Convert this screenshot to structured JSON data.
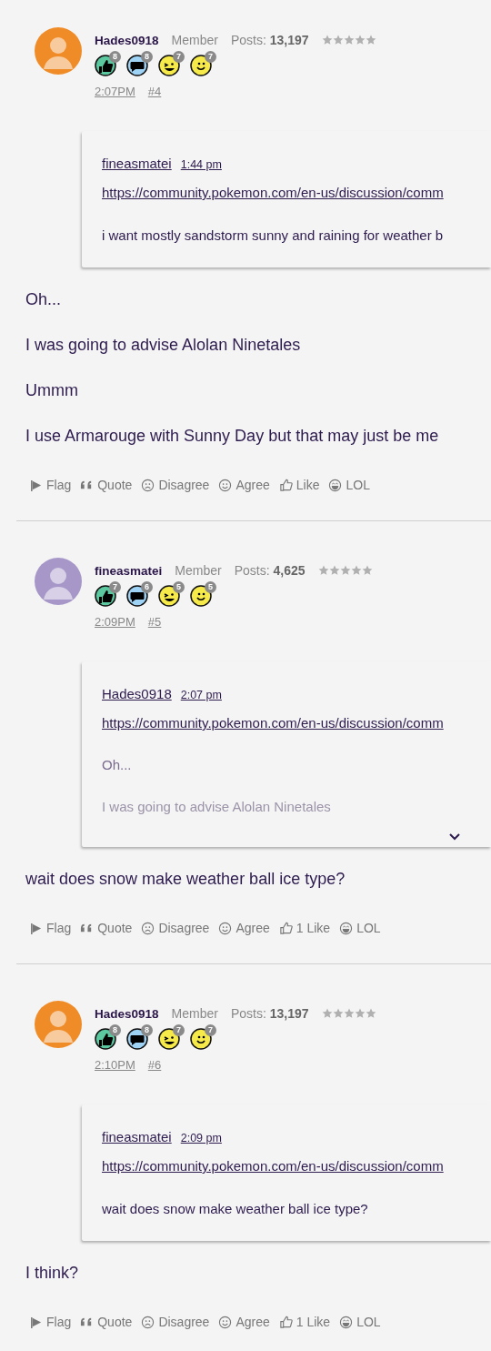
{
  "posts": [
    {
      "author": "Hades0918",
      "color": "#f08c28",
      "role": "Member",
      "posts_label": "Posts:",
      "posts_count": "13,197",
      "stars": 0,
      "badges": [
        {
          "kind": "thumb",
          "count": "8"
        },
        {
          "kind": "comment",
          "count": "8"
        },
        {
          "kind": "wink",
          "count": "7"
        },
        {
          "kind": "smile",
          "count": "7"
        }
      ],
      "time": "2:07PM",
      "number": "#4",
      "quote": {
        "author": "fineasmatei",
        "time": "1:44 pm",
        "link": "https://community.pokemon.com/en-us/discussion/comm",
        "truncated": false,
        "paragraphs": [
          "i want mostly sandstorm sunny and raining for weather b"
        ]
      },
      "paragraphs": [
        "Oh...",
        "I was going to advise Alolan Ninetales",
        "Ummm",
        "I use Armarouge with Sunny Day but that may just be me"
      ],
      "actions": [
        {
          "kind": "flag",
          "label": "Flag"
        },
        {
          "kind": "quote",
          "label": "Quote"
        },
        {
          "kind": "disagree",
          "label": "Disagree"
        },
        {
          "kind": "agree",
          "label": "Agree"
        },
        {
          "kind": "like",
          "label": "Like"
        },
        {
          "kind": "lol",
          "label": "LOL"
        }
      ]
    },
    {
      "author": "fineasmatei",
      "color": "#a697c8",
      "role": "Member",
      "posts_label": "Posts:",
      "posts_count": "4,625",
      "stars": 0,
      "badges": [
        {
          "kind": "thumb",
          "count": "7"
        },
        {
          "kind": "comment",
          "count": "6"
        },
        {
          "kind": "wink",
          "count": "5"
        },
        {
          "kind": "smile",
          "count": "5"
        }
      ],
      "time": "2:09PM",
      "number": "#5",
      "quote": {
        "author": "Hades0918",
        "time": "2:07 pm",
        "link": "https://community.pokemon.com/en-us/discussion/comm",
        "truncated": true,
        "paragraphs": [
          "Oh...",
          "I was going to advise Alolan Ninetales"
        ]
      },
      "paragraphs": [
        "wait does snow make weather ball ice type?"
      ],
      "actions": [
        {
          "kind": "flag",
          "label": "Flag"
        },
        {
          "kind": "quote",
          "label": "Quote"
        },
        {
          "kind": "disagree",
          "label": "Disagree"
        },
        {
          "kind": "agree",
          "label": "Agree"
        },
        {
          "kind": "like",
          "label": "1 Like"
        },
        {
          "kind": "lol",
          "label": "LOL"
        }
      ]
    },
    {
      "author": "Hades0918",
      "color": "#f08c28",
      "role": "Member",
      "posts_label": "Posts:",
      "posts_count": "13,197",
      "stars": 0,
      "badges": [
        {
          "kind": "thumb",
          "count": "8"
        },
        {
          "kind": "comment",
          "count": "8"
        },
        {
          "kind": "wink",
          "count": "7"
        },
        {
          "kind": "smile",
          "count": "7"
        }
      ],
      "time": "2:10PM",
      "number": "#6",
      "quote": {
        "author": "fineasmatei",
        "time": "2:09 pm",
        "link": "https://community.pokemon.com/en-us/discussion/comm",
        "truncated": false,
        "paragraphs": [
          "wait does snow make weather ball ice type?"
        ]
      },
      "paragraphs": [
        "I think?"
      ],
      "actions": [
        {
          "kind": "flag",
          "label": "Flag"
        },
        {
          "kind": "quote",
          "label": "Quote"
        },
        {
          "kind": "disagree",
          "label": "Disagree"
        },
        {
          "kind": "agree",
          "label": "Agree"
        },
        {
          "kind": "like",
          "label": "1 Like"
        },
        {
          "kind": "lol",
          "label": "LOL"
        }
      ]
    }
  ]
}
